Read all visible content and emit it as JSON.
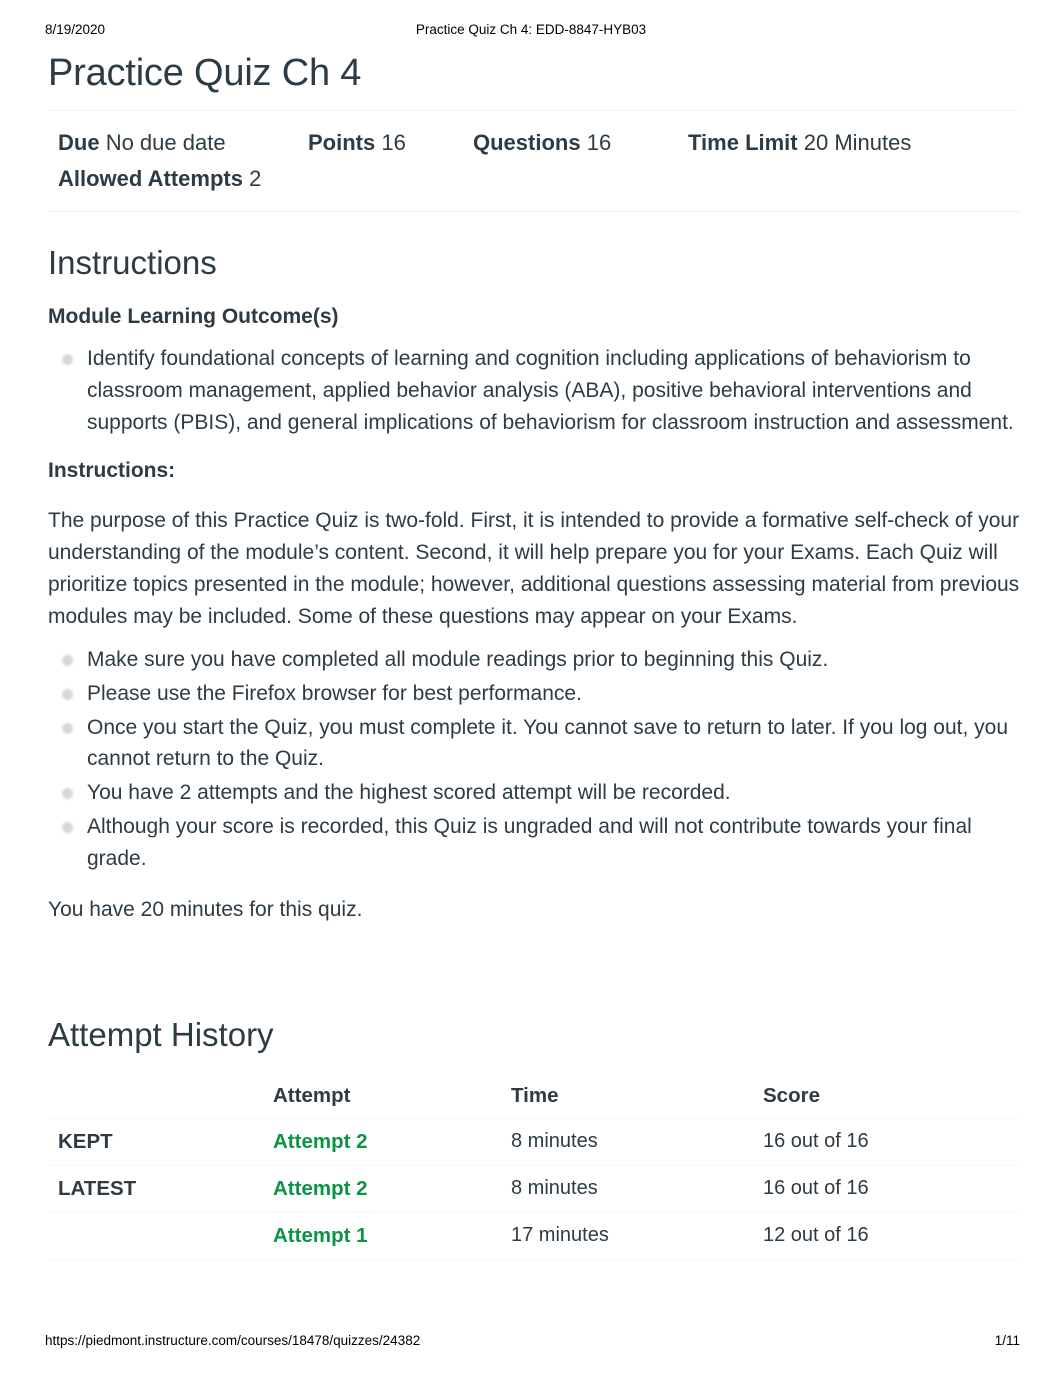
{
  "print_header": {
    "date": "8/19/2020",
    "document_title": "Practice Quiz Ch 4: EDD-8847-HYB03"
  },
  "quiz": {
    "title": "Practice Quiz Ch 4",
    "meta": {
      "due_label": "Due",
      "due_value": "No due date",
      "points_label": "Points",
      "points_value": "16",
      "questions_label": "Questions",
      "questions_value": "16",
      "time_limit_label": "Time Limit",
      "time_limit_value": "20 Minutes",
      "allowed_attempts_label": "Allowed Attempts",
      "allowed_attempts_value": "2"
    }
  },
  "instructions": {
    "heading": "Instructions",
    "outcome_heading": "Module Learning Outcome(s)",
    "outcomes": [
      "Identify foundational concepts of learning and cognition including applications of behaviorism to classroom management, applied behavior analysis (ABA), positive behavioral interventions and supports (PBIS), and general implications of behaviorism for classroom instruction and assessment."
    ],
    "instructions_label": "Instructions:",
    "paragraph": "The purpose of this Practice Quiz is two-fold. First, it is intended to provide a formative self-check of your understanding of the module’s content. Second, it will help prepare you for your Exams. Each Quiz will prioritize topics presented in the module; however, additional questions assessing material from previous modules may be included. Some of these questions may appear on your Exams.",
    "bullets": [
      "Make sure you have completed all module readings prior to beginning this Quiz.",
      "Please use the Firefox browser for best performance.",
      "Once you start the Quiz, you must complete it. You cannot save to return to later. If you log out, you cannot return to the Quiz.",
      "You have 2 attempts and the highest scored attempt will be recorded.",
      "Although your score is recorded, this Quiz is ungraded and will not contribute towards your final grade."
    ],
    "closing_note": "You have 20 minutes for this quiz."
  },
  "attempt_history": {
    "heading": "Attempt History",
    "columns": [
      "",
      "Attempt",
      "Time",
      "Score"
    ],
    "rows": [
      {
        "label": "KEPT",
        "attempt": "Attempt 2",
        "time": "8 minutes",
        "score": "16 out of 16"
      },
      {
        "label": "LATEST",
        "attempt": "Attempt 2",
        "time": "8 minutes",
        "score": "16 out of 16"
      },
      {
        "label": "",
        "attempt": "Attempt 1",
        "time": "17 minutes",
        "score": "12 out of 16"
      }
    ]
  },
  "print_footer": {
    "url": "https://piedmont.instructure.com/courses/18478/quizzes/24382",
    "page_number": "1/11"
  },
  "colors": {
    "link_green": "#0b9444",
    "text": "#2d3b45",
    "bullet_gray": "#d7d7d7"
  }
}
